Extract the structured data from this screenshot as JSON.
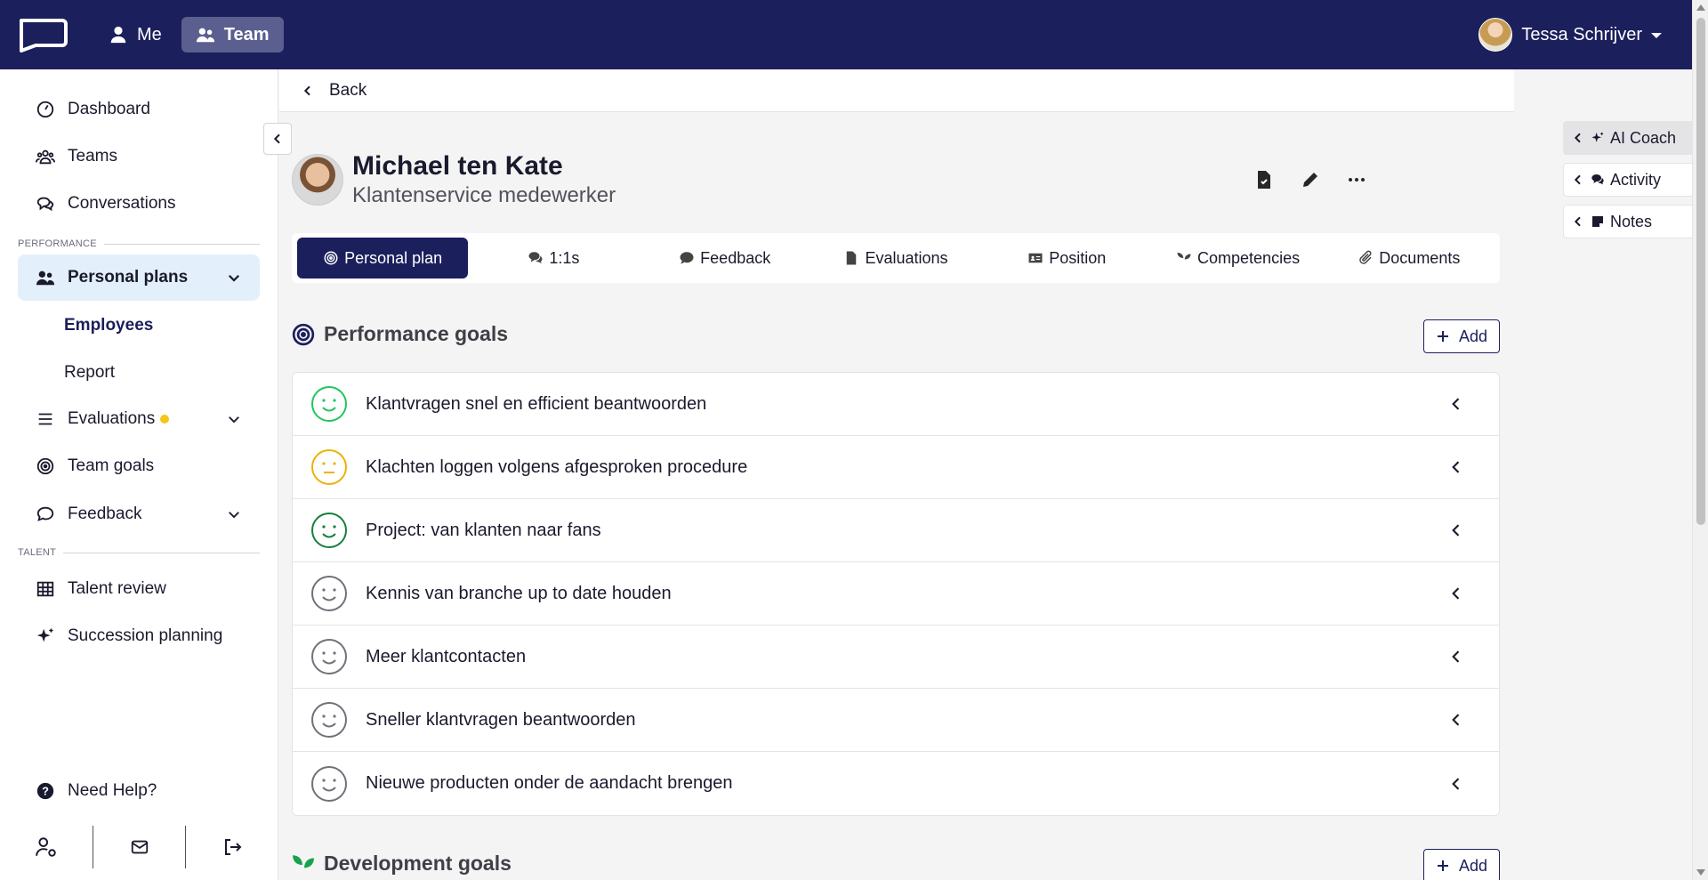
{
  "topbar": {
    "nav": [
      {
        "label": "Me",
        "icon": "user-icon",
        "active": false
      },
      {
        "label": "Team",
        "icon": "users-icon",
        "active": true
      }
    ],
    "user_name": "Tessa Schrijver"
  },
  "sidebar": {
    "items": [
      {
        "label": "Dashboard",
        "icon": "gauge-icon"
      },
      {
        "label": "Teams",
        "icon": "users-icon"
      },
      {
        "label": "Conversations",
        "icon": "chat-icon"
      }
    ],
    "section_performance": "PERFORMANCE",
    "personal_plans": "Personal plans",
    "sub_items": [
      "Employees",
      "Report"
    ],
    "evaluations": "Evaluations",
    "team_goals": "Team goals",
    "feedback": "Feedback",
    "section_talent": "TALENT",
    "talent_review": "Talent review",
    "succession_planning": "Succession planning",
    "need_help": "Need Help?"
  },
  "back_label": "Back",
  "profile": {
    "name": "Michael ten Kate",
    "role": "Klantenservice medewerker"
  },
  "tabs": [
    {
      "label": "Personal plan",
      "icon": "target-icon",
      "active": true
    },
    {
      "label": "1:1s",
      "icon": "comments-icon",
      "active": false
    },
    {
      "label": "Feedback",
      "icon": "comment-icon",
      "active": false
    },
    {
      "label": "Evaluations",
      "icon": "file-icon",
      "active": false
    },
    {
      "label": "Position",
      "icon": "id-card-icon",
      "active": false
    },
    {
      "label": "Competencies",
      "icon": "seedling-icon",
      "active": false
    },
    {
      "label": "Documents",
      "icon": "paperclip-icon",
      "active": false
    }
  ],
  "performance_goals": {
    "title": "Performance goals",
    "add_label": "Add",
    "items": [
      {
        "text": "Klantvragen snel en efficient beantwoorden",
        "mood": "happy",
        "color": "#22c55e"
      },
      {
        "text": "Klachten loggen volgens afgesproken procedure",
        "mood": "neutral",
        "color": "#eab308"
      },
      {
        "text": "Project: van klanten naar fans",
        "mood": "happy",
        "color": "#15803d"
      },
      {
        "text": "Kennis van branche up to date houden",
        "mood": "happy",
        "color": "#71717a"
      },
      {
        "text": "Meer klantcontacten",
        "mood": "happy",
        "color": "#71717a"
      },
      {
        "text": "Sneller klantvragen beantwoorden",
        "mood": "happy",
        "color": "#71717a"
      },
      {
        "text": "Nieuwe producten onder de aandacht brengen",
        "mood": "happy",
        "color": "#71717a"
      }
    ]
  },
  "development_goals": {
    "title": "Development goals",
    "add_label": "Add"
  },
  "right_panel": [
    {
      "label": "AI Coach",
      "icon": "sparkles-icon",
      "active": true
    },
    {
      "label": "Activity",
      "icon": "comments-icon",
      "active": false
    },
    {
      "label": "Notes",
      "icon": "sticky-note-icon",
      "active": false
    }
  ]
}
